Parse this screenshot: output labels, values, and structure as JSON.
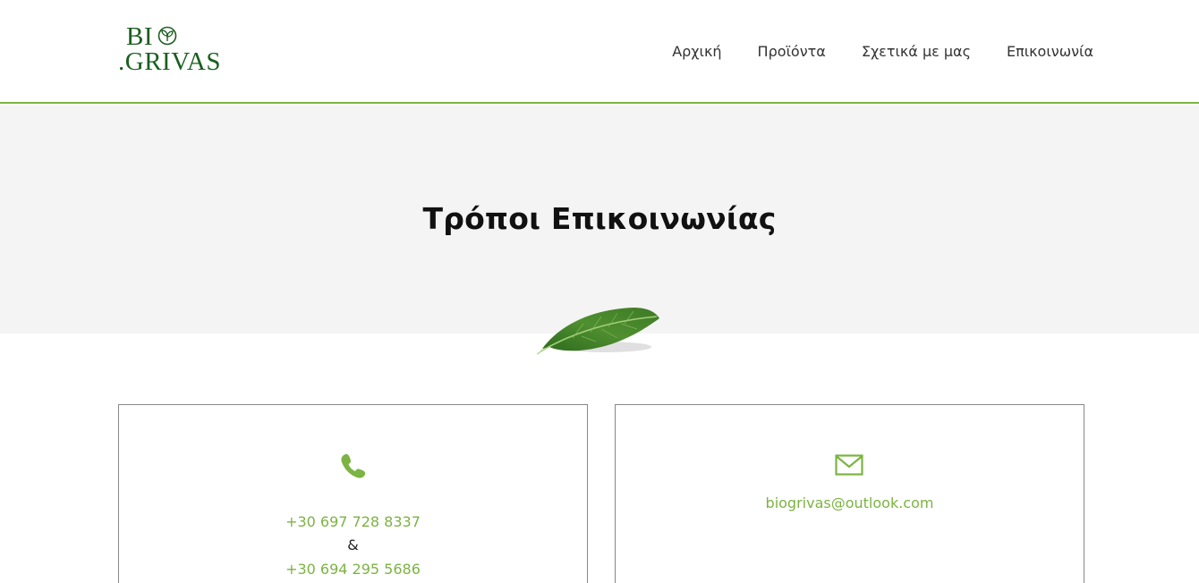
{
  "brand": {
    "logo_line1": "BI",
    "logo_line2": ".GRIVAS",
    "color": "#1b5e20"
  },
  "nav": {
    "items": [
      {
        "label": "Αρχική"
      },
      {
        "label": "Προϊόντα"
      },
      {
        "label": "Σχετικά με μας"
      },
      {
        "label": "Επικοινωνία"
      }
    ]
  },
  "hero": {
    "title": "Τρόποι Επικοινωνίας",
    "decoration": "leaf-icon"
  },
  "contact": {
    "phone": {
      "icon": "phone-icon",
      "number_1": "+30 697 728 8337",
      "separator": "&",
      "number_2": "+30 694 295 5686"
    },
    "email": {
      "icon": "mail-icon",
      "address": "biogrivas@outlook.com"
    }
  },
  "colors": {
    "accent": "#7cb342",
    "hero_bg": "#f4f4f4",
    "logo_green": "#1b5e20"
  }
}
